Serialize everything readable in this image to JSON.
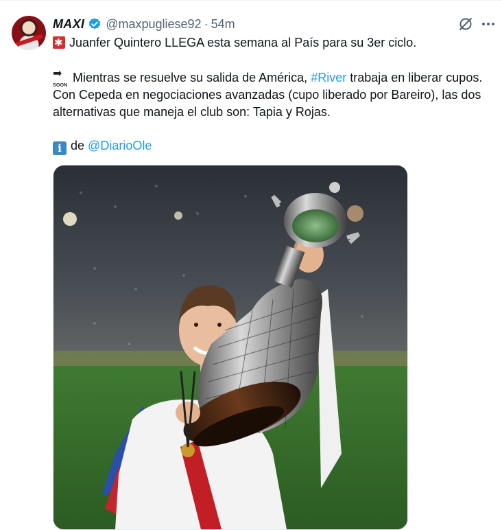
{
  "tweet": {
    "author": {
      "name": "MAXI",
      "handle": "@maxpugliese92",
      "separator": "·",
      "time": "54m"
    },
    "line1": "Juanfer Quintero LLEGA esta semana al País para su 3er ciclo.",
    "para2": {
      "before": "Mientras se resuelve su salida de América,",
      "hashtag": "#River",
      "after": "trabaja en liberar cupos. Con Cepeda en negociaciones avanzadas (cupo liberado por Bareiro), las dos alternativas que maneja el club son: Tapia y Rojas."
    },
    "para3": {
      "prefix": "de",
      "mention": "@DiarioOle"
    },
    "soon_label": "SOON",
    "icons": [
      "siren-icon",
      "soon-arrow-icon",
      "information-icon",
      "verified-badge-icon",
      "grok-icon",
      "more-icon"
    ],
    "colors": {
      "link": "#1d9bf0",
      "secondary_text": "#536471",
      "verified": "#1d9bf0"
    }
  }
}
